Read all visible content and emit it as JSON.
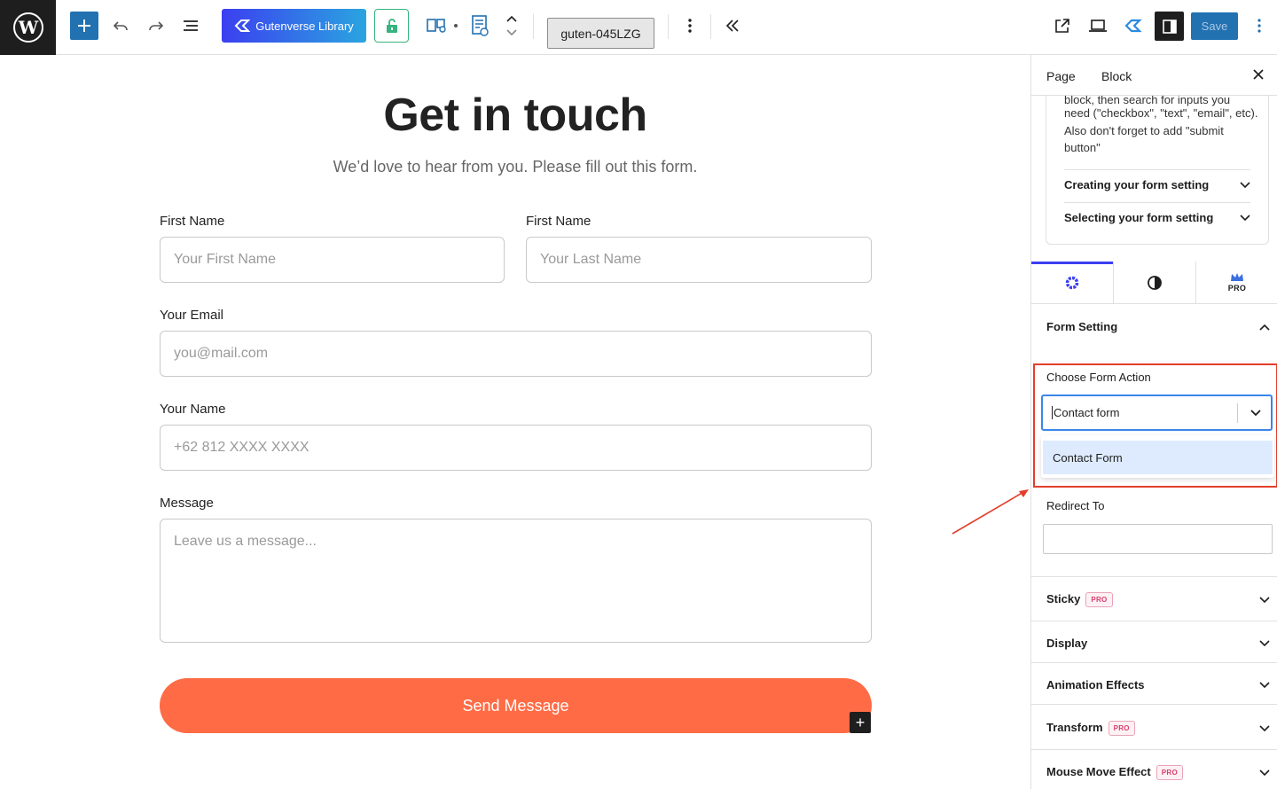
{
  "toolbar": {
    "library_label": "Gutenverse Library",
    "block_id": "guten-045LZG",
    "save_label": "Save"
  },
  "form": {
    "title": "Get in touch",
    "subtitle": "We’d love to hear from you. Please fill out this form.",
    "first_name_label": "First Name",
    "first_name_placeholder": "Your First Name",
    "last_name_label": "First Name",
    "last_name_placeholder": "Your Last Name",
    "email_label": "Your Email",
    "email_placeholder": "you@mail.com",
    "name_label": "Your Name",
    "name_placeholder": "+62 812 XXXX XXXX",
    "message_label": "Message",
    "message_placeholder": "Leave us a message...",
    "submit_label": "Send Message"
  },
  "sidebar": {
    "tab_page": "Page",
    "tab_block": "Block",
    "help_partial_line": "block, then search for inputs you",
    "help_text": "need (\"checkbox\", \"text\", \"email\", etc). Also don't forget to add \"submit button\"",
    "help_items": [
      "Creating your form setting",
      "Selecting your form setting"
    ],
    "pro_tab_label": "PRO",
    "form_setting_title": "Form Setting",
    "choose_action_label": "Choose Form Action",
    "choose_action_value": "Contact form",
    "choose_action_options": [
      "Contact Form"
    ],
    "redirect_label": "Redirect To",
    "sections": [
      {
        "label": "Sticky",
        "pro": "PRO"
      },
      {
        "label": "Display",
        "pro": ""
      },
      {
        "label": "Animation Effects",
        "pro": ""
      },
      {
        "label": "Transform",
        "pro": "PRO"
      },
      {
        "label": "Mouse Move Effect",
        "pro": "PRO"
      }
    ]
  },
  "colors": {
    "accent": "#2271b1",
    "submit": "#ff6b45",
    "highlight": "#e33e2b",
    "gutenverse": "#3b3ff0"
  }
}
